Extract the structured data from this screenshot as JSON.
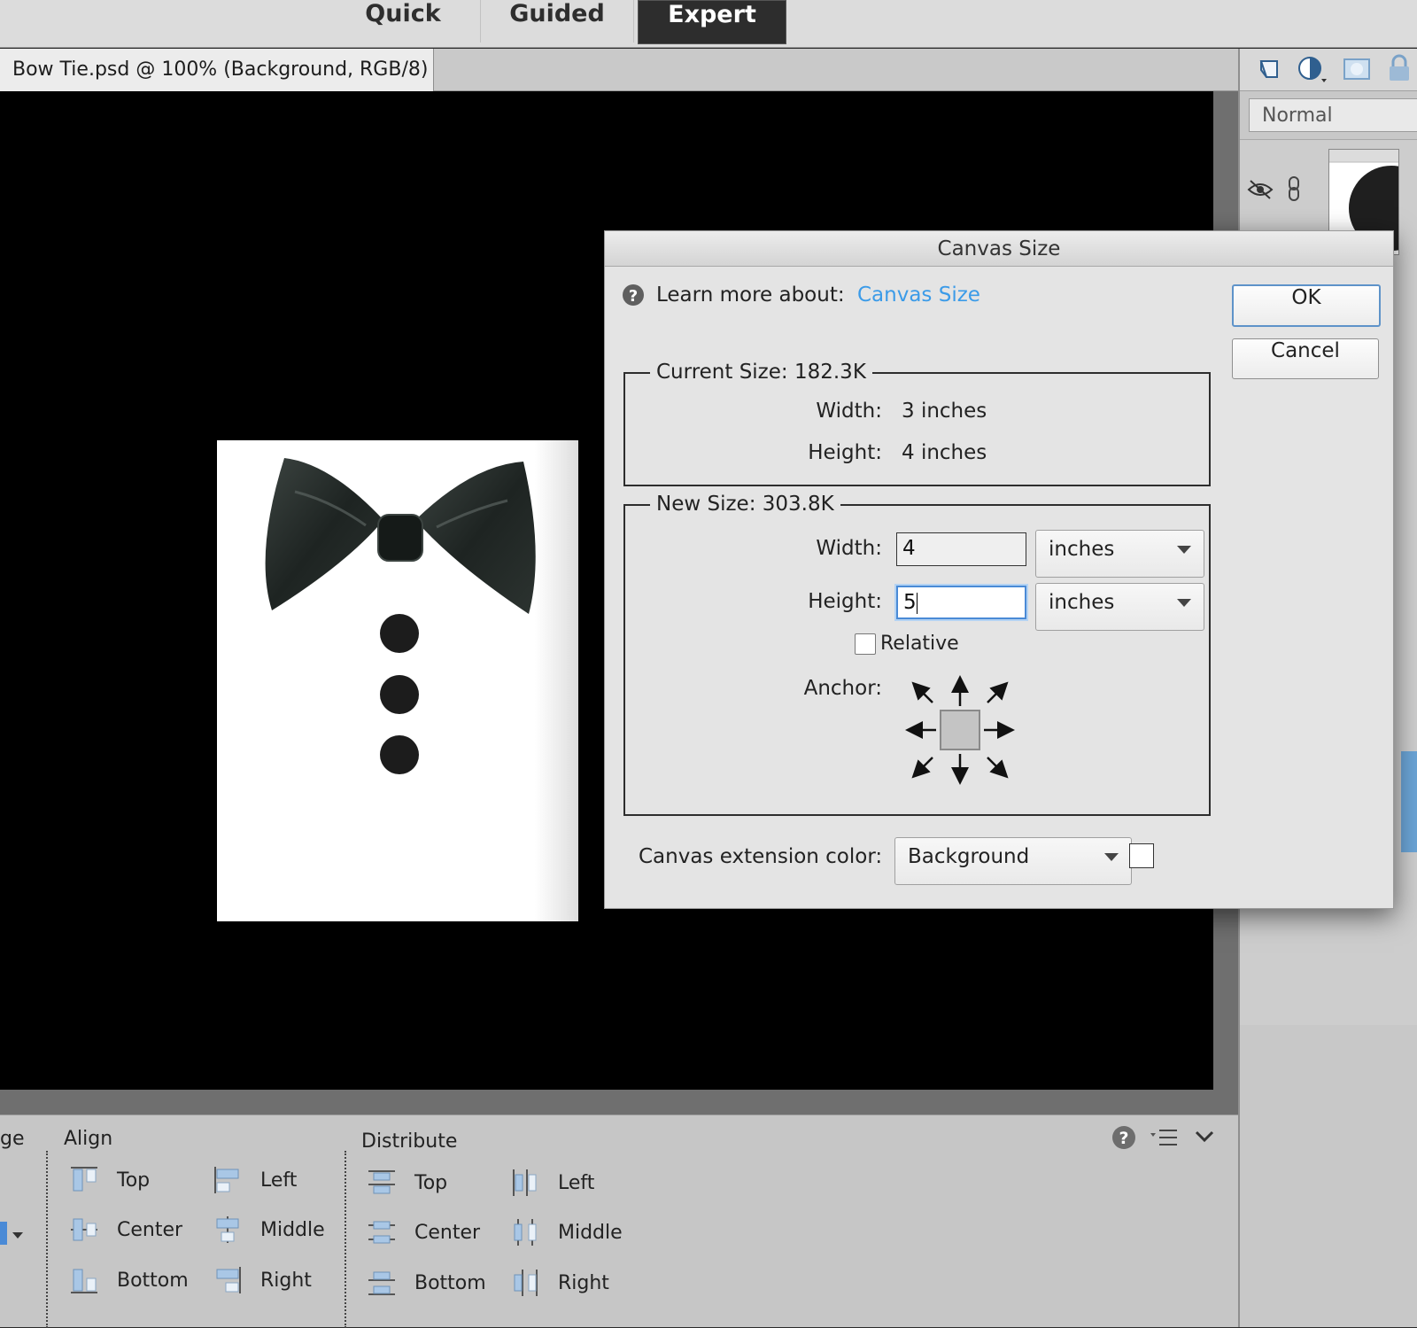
{
  "mode_tabs": {
    "quick": "Quick",
    "guided": "Guided",
    "expert": "Expert",
    "active": "Expert"
  },
  "document": {
    "tab_title": "Bow Tie.psd @ 100% (Background, RGB/8)"
  },
  "layers_panel": {
    "blend_mode": "Normal"
  },
  "options_bar": {
    "partial_label": "ge",
    "align_title": "Align",
    "align_col1": [
      "Top",
      "Center",
      "Bottom"
    ],
    "align_col2": [
      "Left",
      "Middle",
      "Right"
    ],
    "distribute_title": "Distribute",
    "distribute_col1": [
      "Top",
      "Center",
      "Bottom"
    ],
    "distribute_col2": [
      "Left",
      "Middle",
      "Right"
    ]
  },
  "dialog": {
    "title": "Canvas Size",
    "learn_more_prefix": "Learn more about:",
    "learn_more_link": "Canvas Size",
    "ok": "OK",
    "cancel": "Cancel",
    "current_size": {
      "legend": "Current Size: 182.3K",
      "width_label": "Width:",
      "width_value": "3 inches",
      "height_label": "Height:",
      "height_value": "4 inches"
    },
    "new_size": {
      "legend": "New Size: 303.8K",
      "width_label": "Width:",
      "width_value": "4",
      "width_unit": "inches",
      "height_label": "Height:",
      "height_value": "5",
      "height_unit": "inches",
      "relative_label": "Relative",
      "relative_checked": false,
      "anchor_label": "Anchor:"
    },
    "extension": {
      "label": "Canvas extension color:",
      "value": "Background",
      "swatch_color": "#ffffff"
    }
  },
  "colors": {
    "link": "#3b9be8",
    "selection": "#6ba4d6",
    "canvas": "#000000"
  }
}
